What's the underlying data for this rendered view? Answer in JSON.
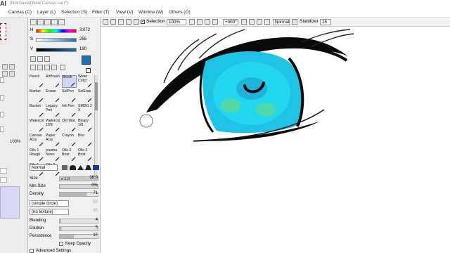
{
  "window": {
    "app_glyph": "AI",
    "title": "(Not Saved)New Canvas.sai (*)"
  },
  "menu": {
    "canvas": "Canvas (C)",
    "layer": "Layer (L)",
    "selection": "Selection (S)",
    "filter": "Filter (T)",
    "view": "View (V)",
    "window": "Window (W)",
    "others": "Others (O)"
  },
  "color_panel": {
    "h_label": "H",
    "h_value": "3:072",
    "s_label": "S",
    "s_value": "255",
    "v_label": "V",
    "v_value": "190",
    "foreground": "#1a73b8"
  },
  "left_strip": {
    "percent": "100%"
  },
  "brushes": [
    [
      "Pencil",
      "AirBrush",
      "Brush",
      "Water Color"
    ],
    [
      "Marker",
      "Eraser",
      "SelPen",
      "SelEras"
    ],
    [
      "Bucket",
      "Legacy Pen",
      "Ink Pen",
      "SMDG 2 X"
    ],
    [
      "Watercol",
      "Watercol 10'E",
      "Old Wat",
      "Binary 1/0"
    ],
    [
      "Canvas Acry",
      "Paper Acry",
      "Crayon",
      "Blur"
    ],
    [
      "Oils 1 Rough",
      "prueba flores",
      "Oils 2 Brist",
      "Oils 2 Brist"
    ],
    [
      "Oils 1 Blend",
      "Oils 2 Blend",
      "",
      ""
    ]
  ],
  "brush_selected": "Brush",
  "params": {
    "mode": "Normal",
    "size_label": "Size",
    "size_mult": "x 1.0",
    "size_value": "38.0",
    "minsize_label": "Min Size",
    "minsize_value": "0%",
    "density_label": "Density",
    "density_value": "71",
    "shape_select": "(simple circle)",
    "shape_value": "50",
    "texture_select": "(no texture)",
    "texture_value": "95",
    "blending_label": "Blending",
    "blending_value": "4",
    "dilution_label": "Dilution",
    "dilution_value": "5",
    "persistence_label": "Persistence",
    "persistence_value": "37",
    "keep_opacity": "Keep Opacity",
    "advanced": "Advanced Settings"
  },
  "canvas_toolbar": {
    "selection_label": "Selection",
    "zoom": "100%",
    "angle": "+000°",
    "mode": "Normal",
    "stabilizer_label": "Stabilizer",
    "stabilizer_value": "15"
  },
  "colors": {
    "iris_outer": "#1fc3e6",
    "iris_inner": "#22e0f0",
    "iris_green": "#62d890",
    "ink": "#0a0a0a"
  }
}
